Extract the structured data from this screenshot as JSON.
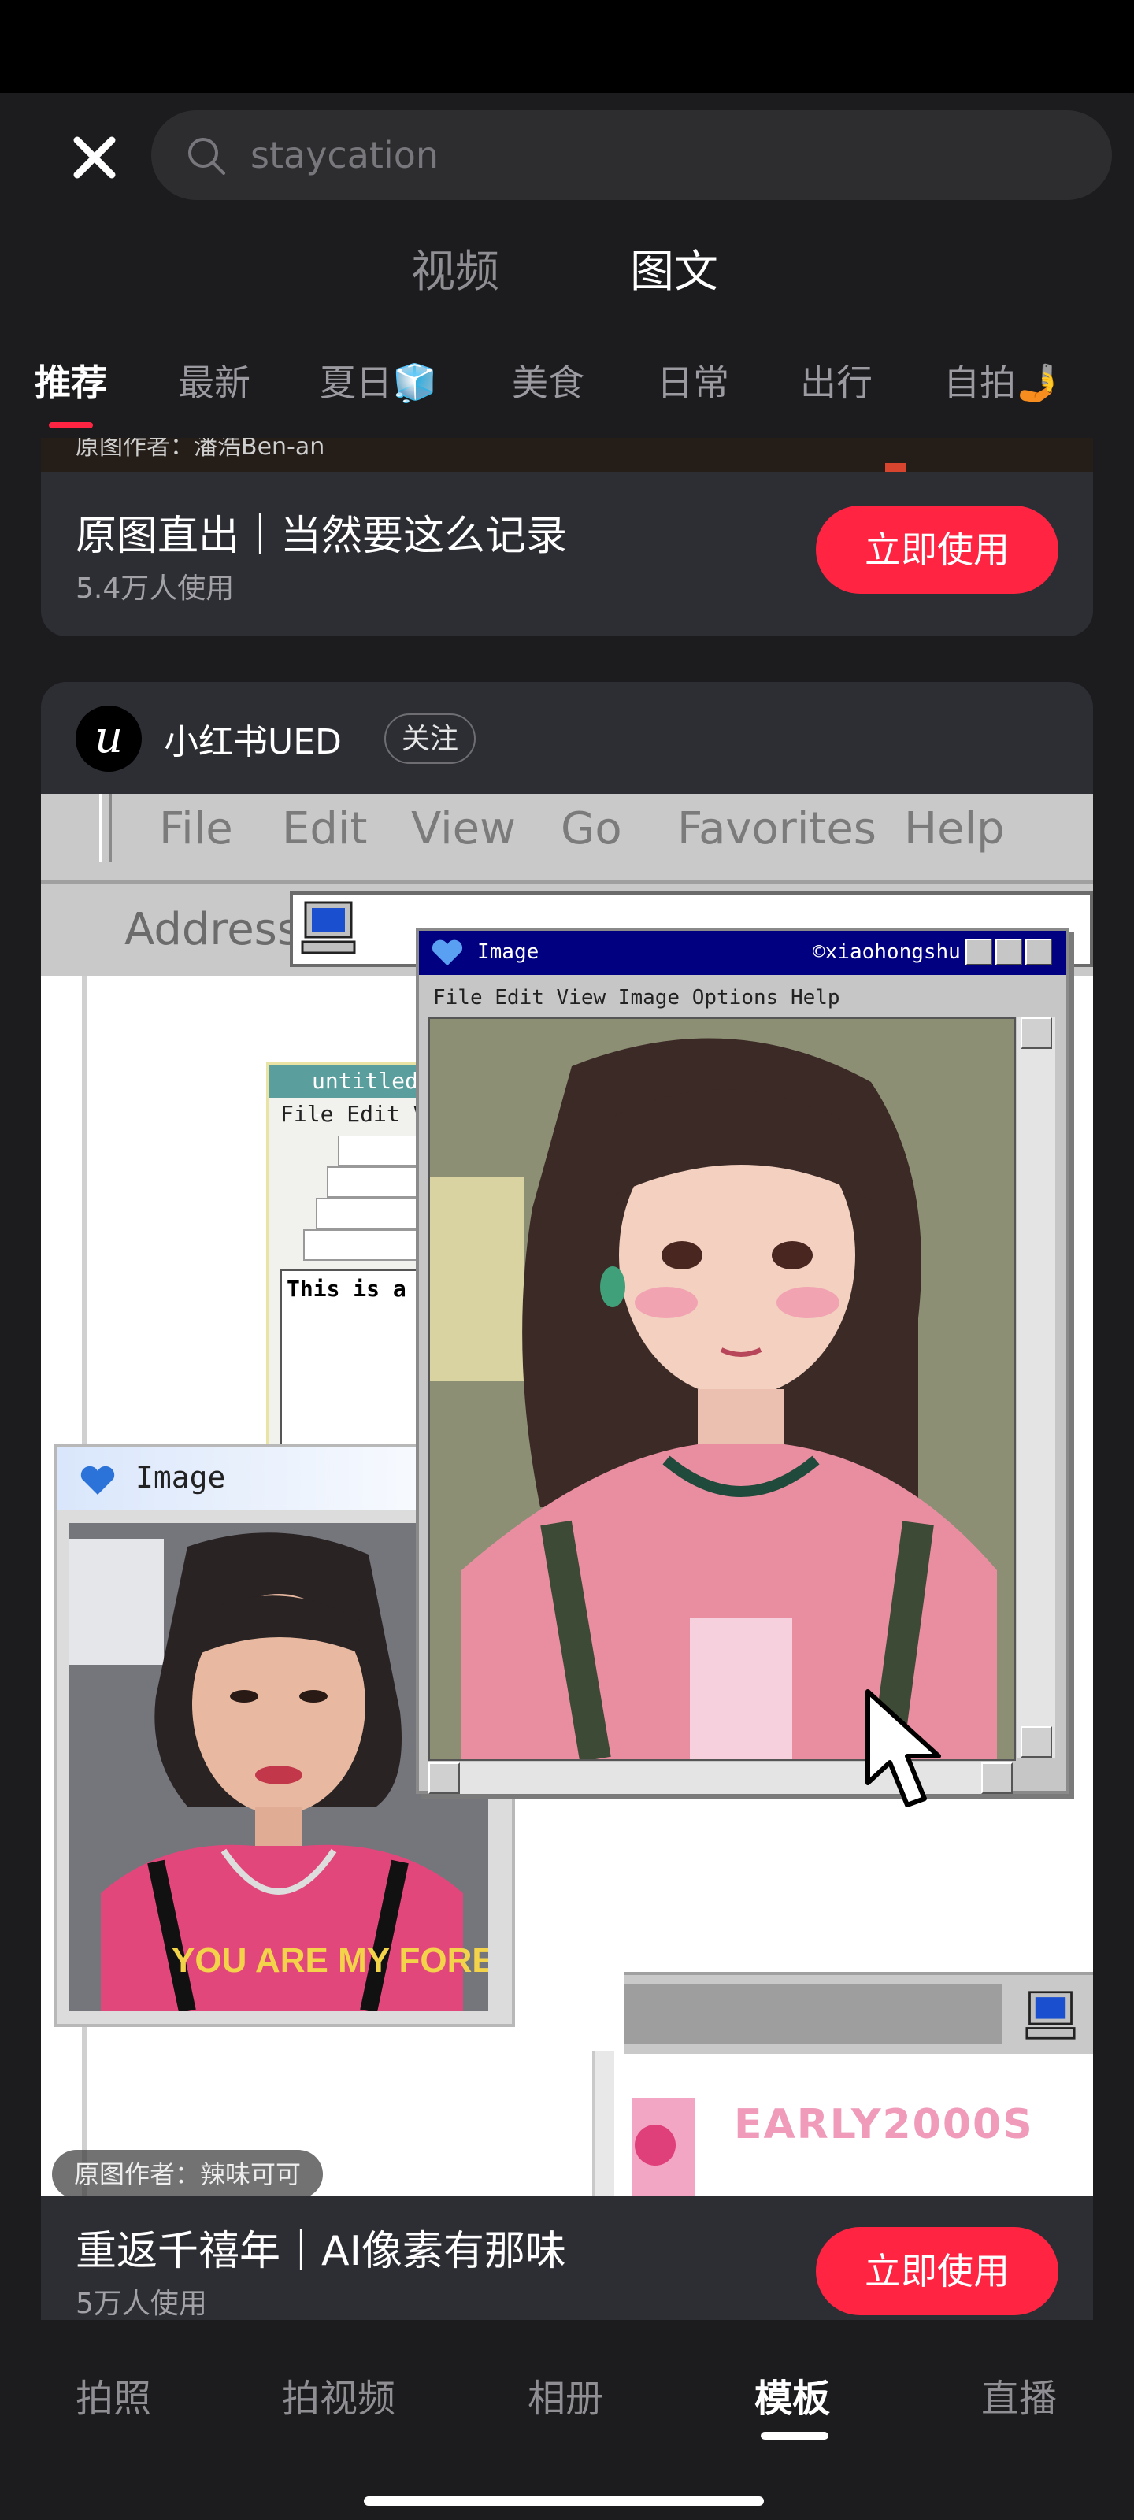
{
  "search": {
    "placeholder": "staycation"
  },
  "media_tabs": [
    {
      "label": "视频"
    },
    {
      "label": "图文",
      "active": true
    }
  ],
  "category_tabs": [
    {
      "label": "推荐",
      "active": true
    },
    {
      "label": "最新"
    },
    {
      "label": "夏日🧊"
    },
    {
      "label": "美食"
    },
    {
      "label": "日常"
    },
    {
      "label": "出行"
    },
    {
      "label": "自拍🤳"
    }
  ],
  "card1": {
    "credit": "原图作者：潘浩Ben-an",
    "title": "原图直出｜当然要这么记录",
    "usage": "5.4万人使用",
    "button": "立即使用"
  },
  "card2": {
    "author": {
      "avatar_letter": "u",
      "name": "小红书UED",
      "follow_label": "关注"
    },
    "image": {
      "browser_menu": [
        "File",
        "Edit",
        "View",
        "Go",
        "Favorites",
        "Help"
      ],
      "address_label": "Address",
      "untitled_window": {
        "title": "untitled -",
        "menu": "File  Edit  V",
        "doc_text": "This is a r"
      },
      "small_window_title": "Image",
      "big_window": {
        "title": "Image",
        "handle": "©xiaohongshu",
        "menu": "File  Edit  View  Image  Options  Help"
      },
      "shirt_text": "YOU ARE MY FOREVER",
      "early_text": "EARLY2000S",
      "credit": "原图作者：辣味可可"
    },
    "title": "重返千禧年｜AI像素有那味",
    "usage": "5万人使用",
    "button": "立即使用"
  },
  "bottom_nav": [
    {
      "label": "拍照"
    },
    {
      "label": "拍视频"
    },
    {
      "label": "相册"
    },
    {
      "label": "模板",
      "active": true
    },
    {
      "label": "直播"
    }
  ],
  "colors": {
    "accent": "#ff2442",
    "background": "#1c1c1e",
    "card": "#2d2e34"
  },
  "icons": [
    "close-icon",
    "search-icon",
    "heart-icon",
    "computer-icon",
    "mouse-cursor-icon"
  ]
}
